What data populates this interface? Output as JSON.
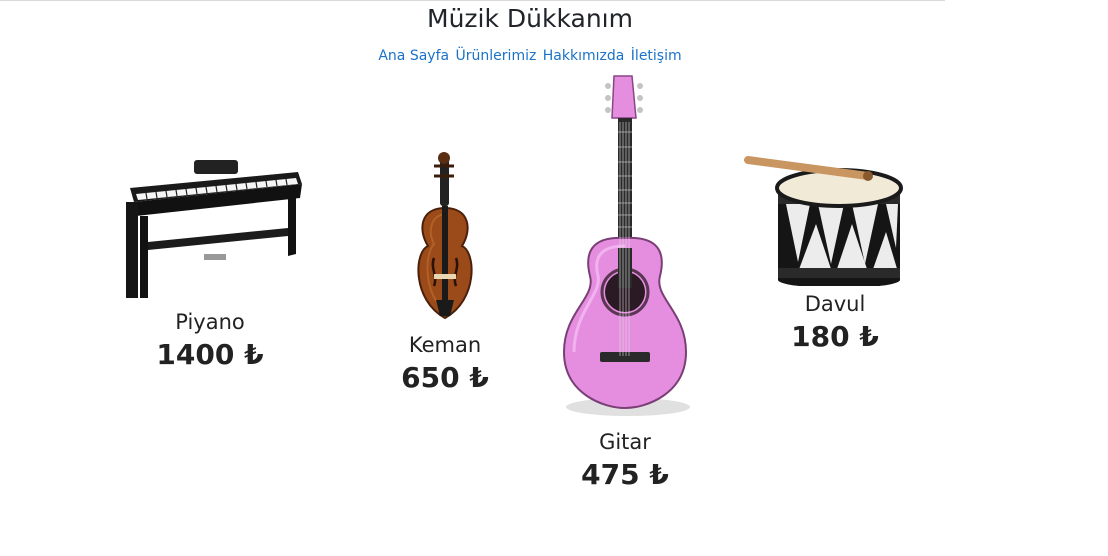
{
  "header": {
    "title": "Müzik Dükkanım",
    "nav": [
      "Ana Sayfa",
      "Ürünlerimiz",
      "Hakkımızda",
      "İletişim"
    ]
  },
  "products": [
    {
      "name": "Piyano",
      "price": "1400 ₺",
      "icon": "piano-image"
    },
    {
      "name": "Keman",
      "price": "650 ₺",
      "icon": "violin-image"
    },
    {
      "name": "Gitar",
      "price": "475 ₺",
      "icon": "guitar-image"
    },
    {
      "name": "Davul",
      "price": "180 ₺",
      "icon": "drum-image"
    }
  ],
  "colors": {
    "link": "#1a73c8",
    "text": "#212529",
    "guitar": "#e58ee0"
  }
}
